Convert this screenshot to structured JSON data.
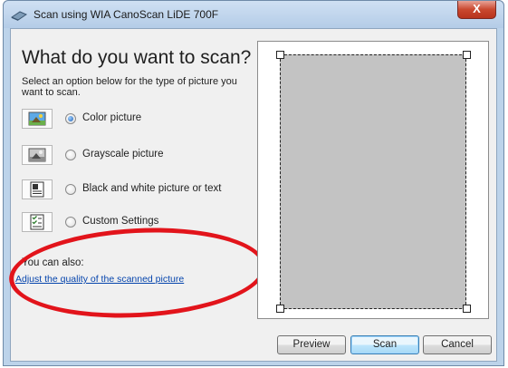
{
  "window": {
    "title": "Scan using WIA CanoScan LiDE 700F",
    "close_glyph": "X"
  },
  "main": {
    "heading": "What do you want to scan?",
    "description": "Select an option below for the type of picture you want to scan."
  },
  "options": [
    {
      "label": "Color picture",
      "icon": "color-picture-icon",
      "selected": true
    },
    {
      "label": "Grayscale picture",
      "icon": "grayscale-picture-icon",
      "selected": false
    },
    {
      "label": "Black and white picture or text",
      "icon": "black-white-text-icon",
      "selected": false
    },
    {
      "label": "Custom Settings",
      "icon": "custom-settings-icon",
      "selected": false
    }
  ],
  "also": {
    "label": "You can also:",
    "link": "Adjust the quality of the scanned picture"
  },
  "buttons": {
    "preview": "Preview",
    "scan": "Scan",
    "cancel": "Cancel"
  },
  "colors": {
    "link": "#0645ad",
    "highlight_ellipse": "#e2141b"
  }
}
